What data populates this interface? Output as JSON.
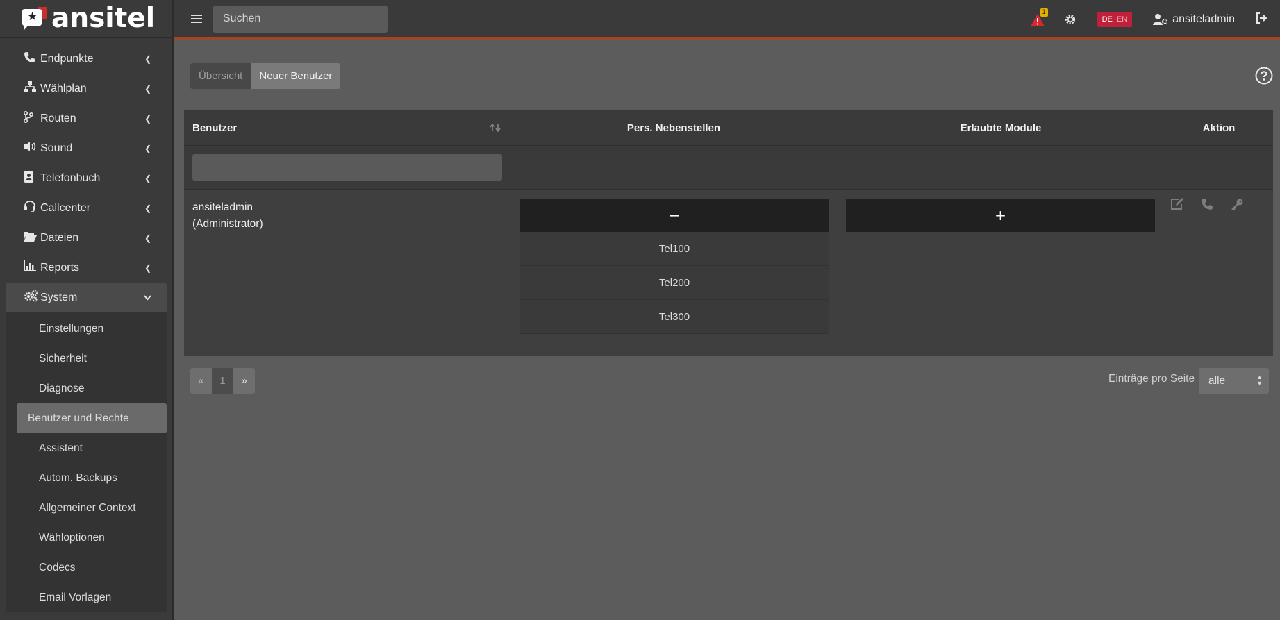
{
  "brand": {
    "name": "ansitel"
  },
  "topbar": {
    "search_placeholder": "Suchen",
    "alert_count": "1",
    "lang_de": "DE",
    "lang_en": "EN",
    "username": "ansiteladmin"
  },
  "sidebar": {
    "items": [
      {
        "label": "Endpunkte",
        "icon": "phone-icon"
      },
      {
        "label": "Wählplan",
        "icon": "sitemap-icon"
      },
      {
        "label": "Routen",
        "icon": "route-icon"
      },
      {
        "label": "Sound",
        "icon": "volume-icon"
      },
      {
        "label": "Telefonbuch",
        "icon": "address-book-icon"
      },
      {
        "label": "Callcenter",
        "icon": "headset-icon"
      },
      {
        "label": "Dateien",
        "icon": "folder-open-icon"
      },
      {
        "label": "Reports",
        "icon": "chart-icon"
      },
      {
        "label": "System",
        "icon": "cogs-icon"
      }
    ],
    "system_sub": [
      "Einstellungen",
      "Sicherheit",
      "Diagnose",
      "Benutzer und Rechte",
      "Assistent",
      "Autom. Backups",
      "Allgemeiner Context",
      "Wähloptionen",
      "Codecs",
      "Email Vorlagen"
    ]
  },
  "main": {
    "tabs": {
      "overview": "Übersicht",
      "new_user": "Neuer Benutzer"
    },
    "table": {
      "headers": [
        "Benutzer",
        "Pers. Nebenstellen",
        "Erlaubte Module",
        "Aktion"
      ],
      "rows": [
        {
          "user": "ansiteladmin",
          "role": "(Administrator)",
          "extensions_toggle": "−",
          "extensions": [
            "Tel100",
            "Tel200",
            "Tel300"
          ],
          "modules_toggle": "+"
        }
      ]
    },
    "pagination": {
      "prev": "«",
      "page": "1",
      "next": "»"
    },
    "per_page": {
      "label": "Einträge pro Seite",
      "value": "alle"
    }
  },
  "colors": {
    "accent": "#a0442a",
    "lang_badge": "#c0213a",
    "alert": "#d9282f"
  }
}
